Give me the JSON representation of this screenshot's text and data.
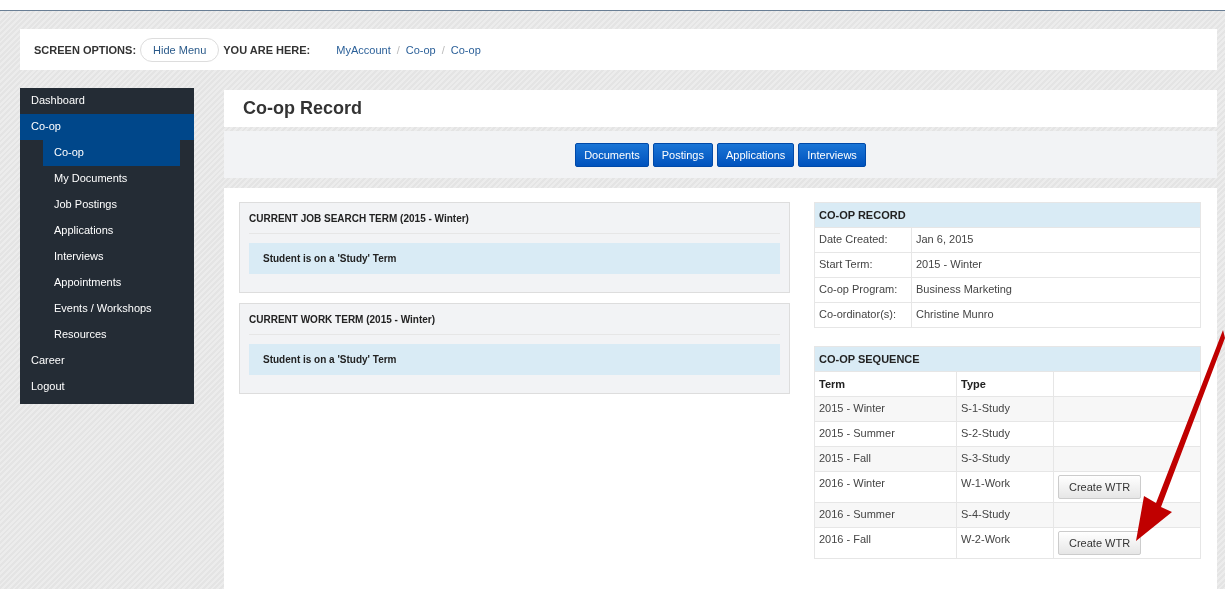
{
  "screen_options": {
    "label": "SCREEN OPTIONS:",
    "button": "Hide Menu"
  },
  "breadcrumb": {
    "label": "YOU ARE HERE:",
    "separator": "/",
    "items": [
      "MyAccount",
      "Co-op",
      "Co-op"
    ]
  },
  "sidebar": {
    "items": [
      {
        "label": "Dashboard",
        "selected": false
      },
      {
        "label": "Co-op",
        "selected": true,
        "children": [
          {
            "label": "Co-op",
            "selected": true
          },
          {
            "label": "My Documents",
            "selected": false
          },
          {
            "label": "Job Postings",
            "selected": false
          },
          {
            "label": "Applications",
            "selected": false
          },
          {
            "label": "Interviews",
            "selected": false
          },
          {
            "label": "Appointments",
            "selected": false
          },
          {
            "label": "Events / Workshops",
            "selected": false
          },
          {
            "label": "Resources",
            "selected": false
          }
        ]
      },
      {
        "label": "Career",
        "selected": false
      },
      {
        "label": "Logout",
        "selected": false
      }
    ]
  },
  "page_title": "Co-op Record",
  "toolbar_buttons": [
    "Documents",
    "Postings",
    "Applications",
    "Interviews"
  ],
  "term_panels": [
    {
      "title": "CURRENT JOB SEARCH TERM (2015 - Winter)",
      "message": "Student is on a 'Study' Term"
    },
    {
      "title": "CURRENT WORK TERM (2015 - Winter)",
      "message": "Student is on a 'Study' Term"
    }
  ],
  "coop_record": {
    "title": "CO-OP RECORD",
    "rows": [
      {
        "label": "Date Created:",
        "value": "Jan 6, 2015"
      },
      {
        "label": "Start Term:",
        "value": "2015 - Winter"
      },
      {
        "label": "Co-op Program:",
        "value": "Business Marketing"
      },
      {
        "label": "Co-ordinator(s):",
        "value": "Christine Munro"
      }
    ]
  },
  "coop_sequence": {
    "title": "CO-OP SEQUENCE",
    "columns": [
      "Term",
      "Type"
    ],
    "rows": [
      {
        "term": "2015 - Winter",
        "type": "S-1-Study"
      },
      {
        "term": "2015 - Summer",
        "type": "S-2-Study"
      },
      {
        "term": "2015 - Fall",
        "type": "S-3-Study"
      },
      {
        "term": "2016 - Winter",
        "type": "W-1-Work",
        "action": "Create WTR"
      },
      {
        "term": "2016 - Summer",
        "type": "S-4-Study"
      },
      {
        "term": "2016 - Fall",
        "type": "W-2-Work",
        "action": "Create WTR"
      }
    ]
  }
}
